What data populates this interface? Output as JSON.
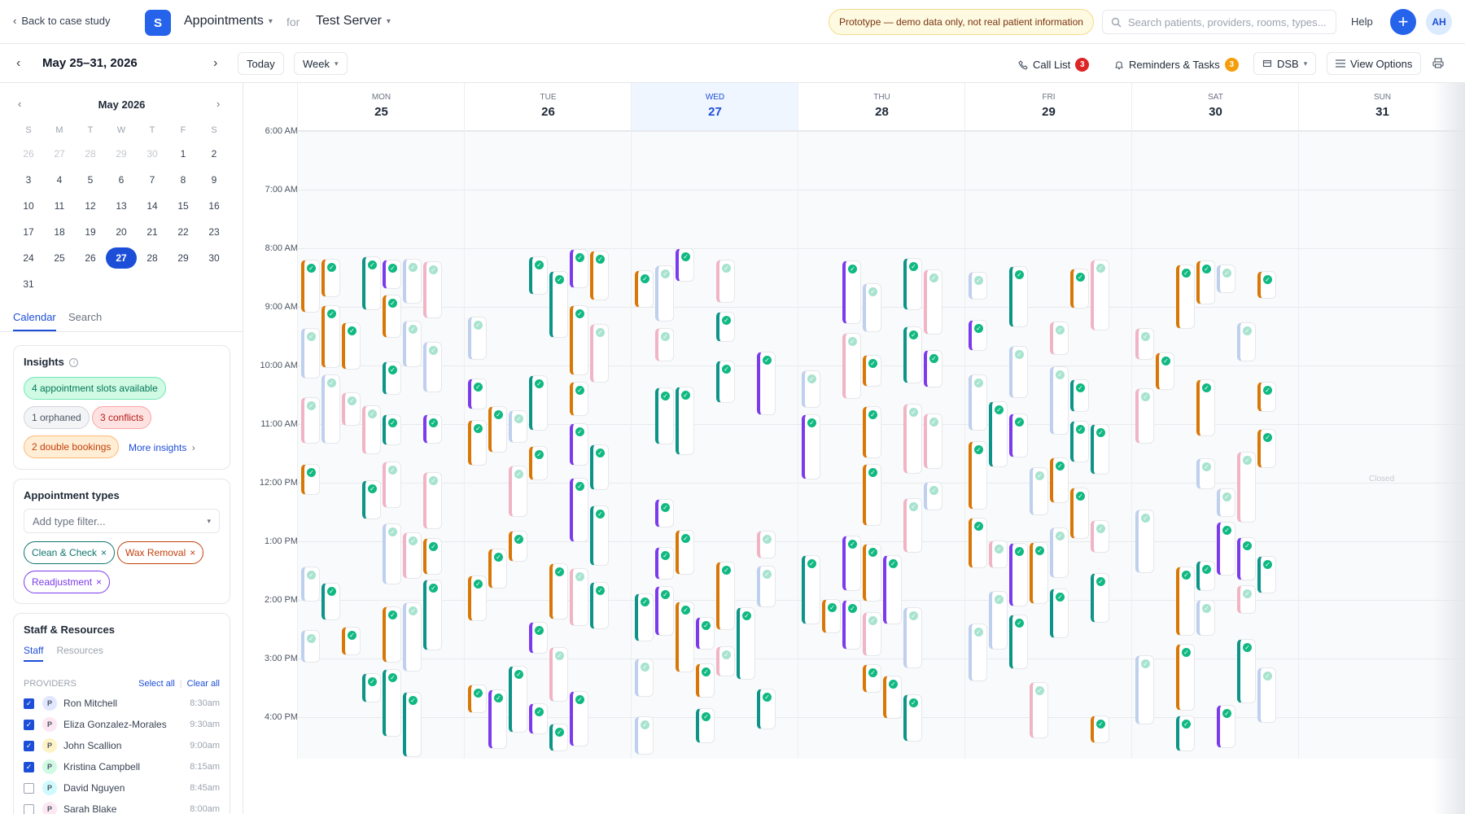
{
  "header": {
    "back_label": "Back to case study",
    "logo_letter": "S",
    "app_name": "Appointments",
    "for_label": "for",
    "server_name": "Test Server",
    "prototype_banner": "Prototype — demo data only, not real patient information",
    "search_placeholder": "Search patients, providers, rooms, types...",
    "help_label": "Help",
    "add_label": "+",
    "user_initials": "AH"
  },
  "toolbar": {
    "date_range": "May 25–31, 2026",
    "today_label": "Today",
    "view_label": "Week",
    "call_list_label": "Call List",
    "call_list_count": "3",
    "reminders_label": "Reminders & Tasks",
    "reminders_count": "3",
    "location_label": "DSB",
    "view_options_label": "View Options"
  },
  "mini_calendar": {
    "title": "May 2026",
    "weekdays": [
      "S",
      "M",
      "T",
      "W",
      "T",
      "F",
      "S"
    ],
    "weeks": [
      [
        "26",
        "27",
        "28",
        "29",
        "30",
        "1",
        "2"
      ],
      [
        "3",
        "4",
        "5",
        "6",
        "7",
        "8",
        "9"
      ],
      [
        "10",
        "11",
        "12",
        "13",
        "14",
        "15",
        "16"
      ],
      [
        "17",
        "18",
        "19",
        "20",
        "21",
        "22",
        "23"
      ],
      [
        "24",
        "25",
        "26",
        "27",
        "28",
        "29",
        "30"
      ],
      [
        "31"
      ]
    ],
    "selected": "27"
  },
  "sidebar_tabs": {
    "calendar": "Calendar",
    "search": "Search"
  },
  "insights": {
    "title": "Insights",
    "slots": "4 appointment slots available",
    "orphaned": "1 orphaned",
    "conflicts": "3 conflicts",
    "double_bookings": "2 double bookings",
    "more": "More insights"
  },
  "appointment_types": {
    "title": "Appointment types",
    "filter_placeholder": "Add type filter...",
    "chips": [
      "Clean & Check",
      "Wax Removal",
      "Readjustment"
    ]
  },
  "staff": {
    "title": "Staff & Resources",
    "tab_staff": "Staff",
    "tab_resources": "Resources",
    "providers_label": "PROVIDERS",
    "select_all": "Select all",
    "clear_all": "Clear all",
    "providers": [
      {
        "name": "Ron Mitchell",
        "time": "8:30am",
        "checked": true,
        "initial": "P",
        "color": "#e0e7ff"
      },
      {
        "name": "Eliza Gonzalez-Morales",
        "time": "9:30am",
        "checked": true,
        "initial": "P",
        "color": "#fce7f3"
      },
      {
        "name": "John Scallion",
        "time": "9:00am",
        "checked": true,
        "initial": "P",
        "color": "#fef3c7"
      },
      {
        "name": "Kristina Campbell",
        "time": "8:15am",
        "checked": true,
        "initial": "P",
        "color": "#d1fae5"
      },
      {
        "name": "David Nguyen",
        "time": "8:45am",
        "checked": false,
        "initial": "P",
        "color": "#cffafe"
      },
      {
        "name": "Sarah Blake",
        "time": "8:00am",
        "checked": false,
        "initial": "P",
        "color": "#fce7f3"
      }
    ]
  },
  "week": {
    "hours": [
      "6:00 AM",
      "7:00 AM",
      "8:00 AM",
      "9:00 AM",
      "10:00 AM",
      "11:00 AM",
      "12:00 PM",
      "1:00 PM",
      "2:00 PM",
      "3:00 PM",
      "4:00 PM"
    ],
    "days": [
      {
        "dow": "MON",
        "num": "25"
      },
      {
        "dow": "TUE",
        "num": "26"
      },
      {
        "dow": "WED",
        "num": "27",
        "today": true
      },
      {
        "dow": "THU",
        "num": "28"
      },
      {
        "dow": "FRI",
        "num": "29"
      },
      {
        "dow": "SAT",
        "num": "30"
      },
      {
        "dow": "SUN",
        "num": "31",
        "closed_label": "Closed"
      }
    ]
  },
  "colors": {
    "accent": "#2563eb",
    "clean_check": "#0d9488",
    "wax_removal": "#d97706",
    "readjustment": "#7c3aed",
    "other_pink": "#f0b4c4",
    "other_blue": "#bfcfee"
  }
}
